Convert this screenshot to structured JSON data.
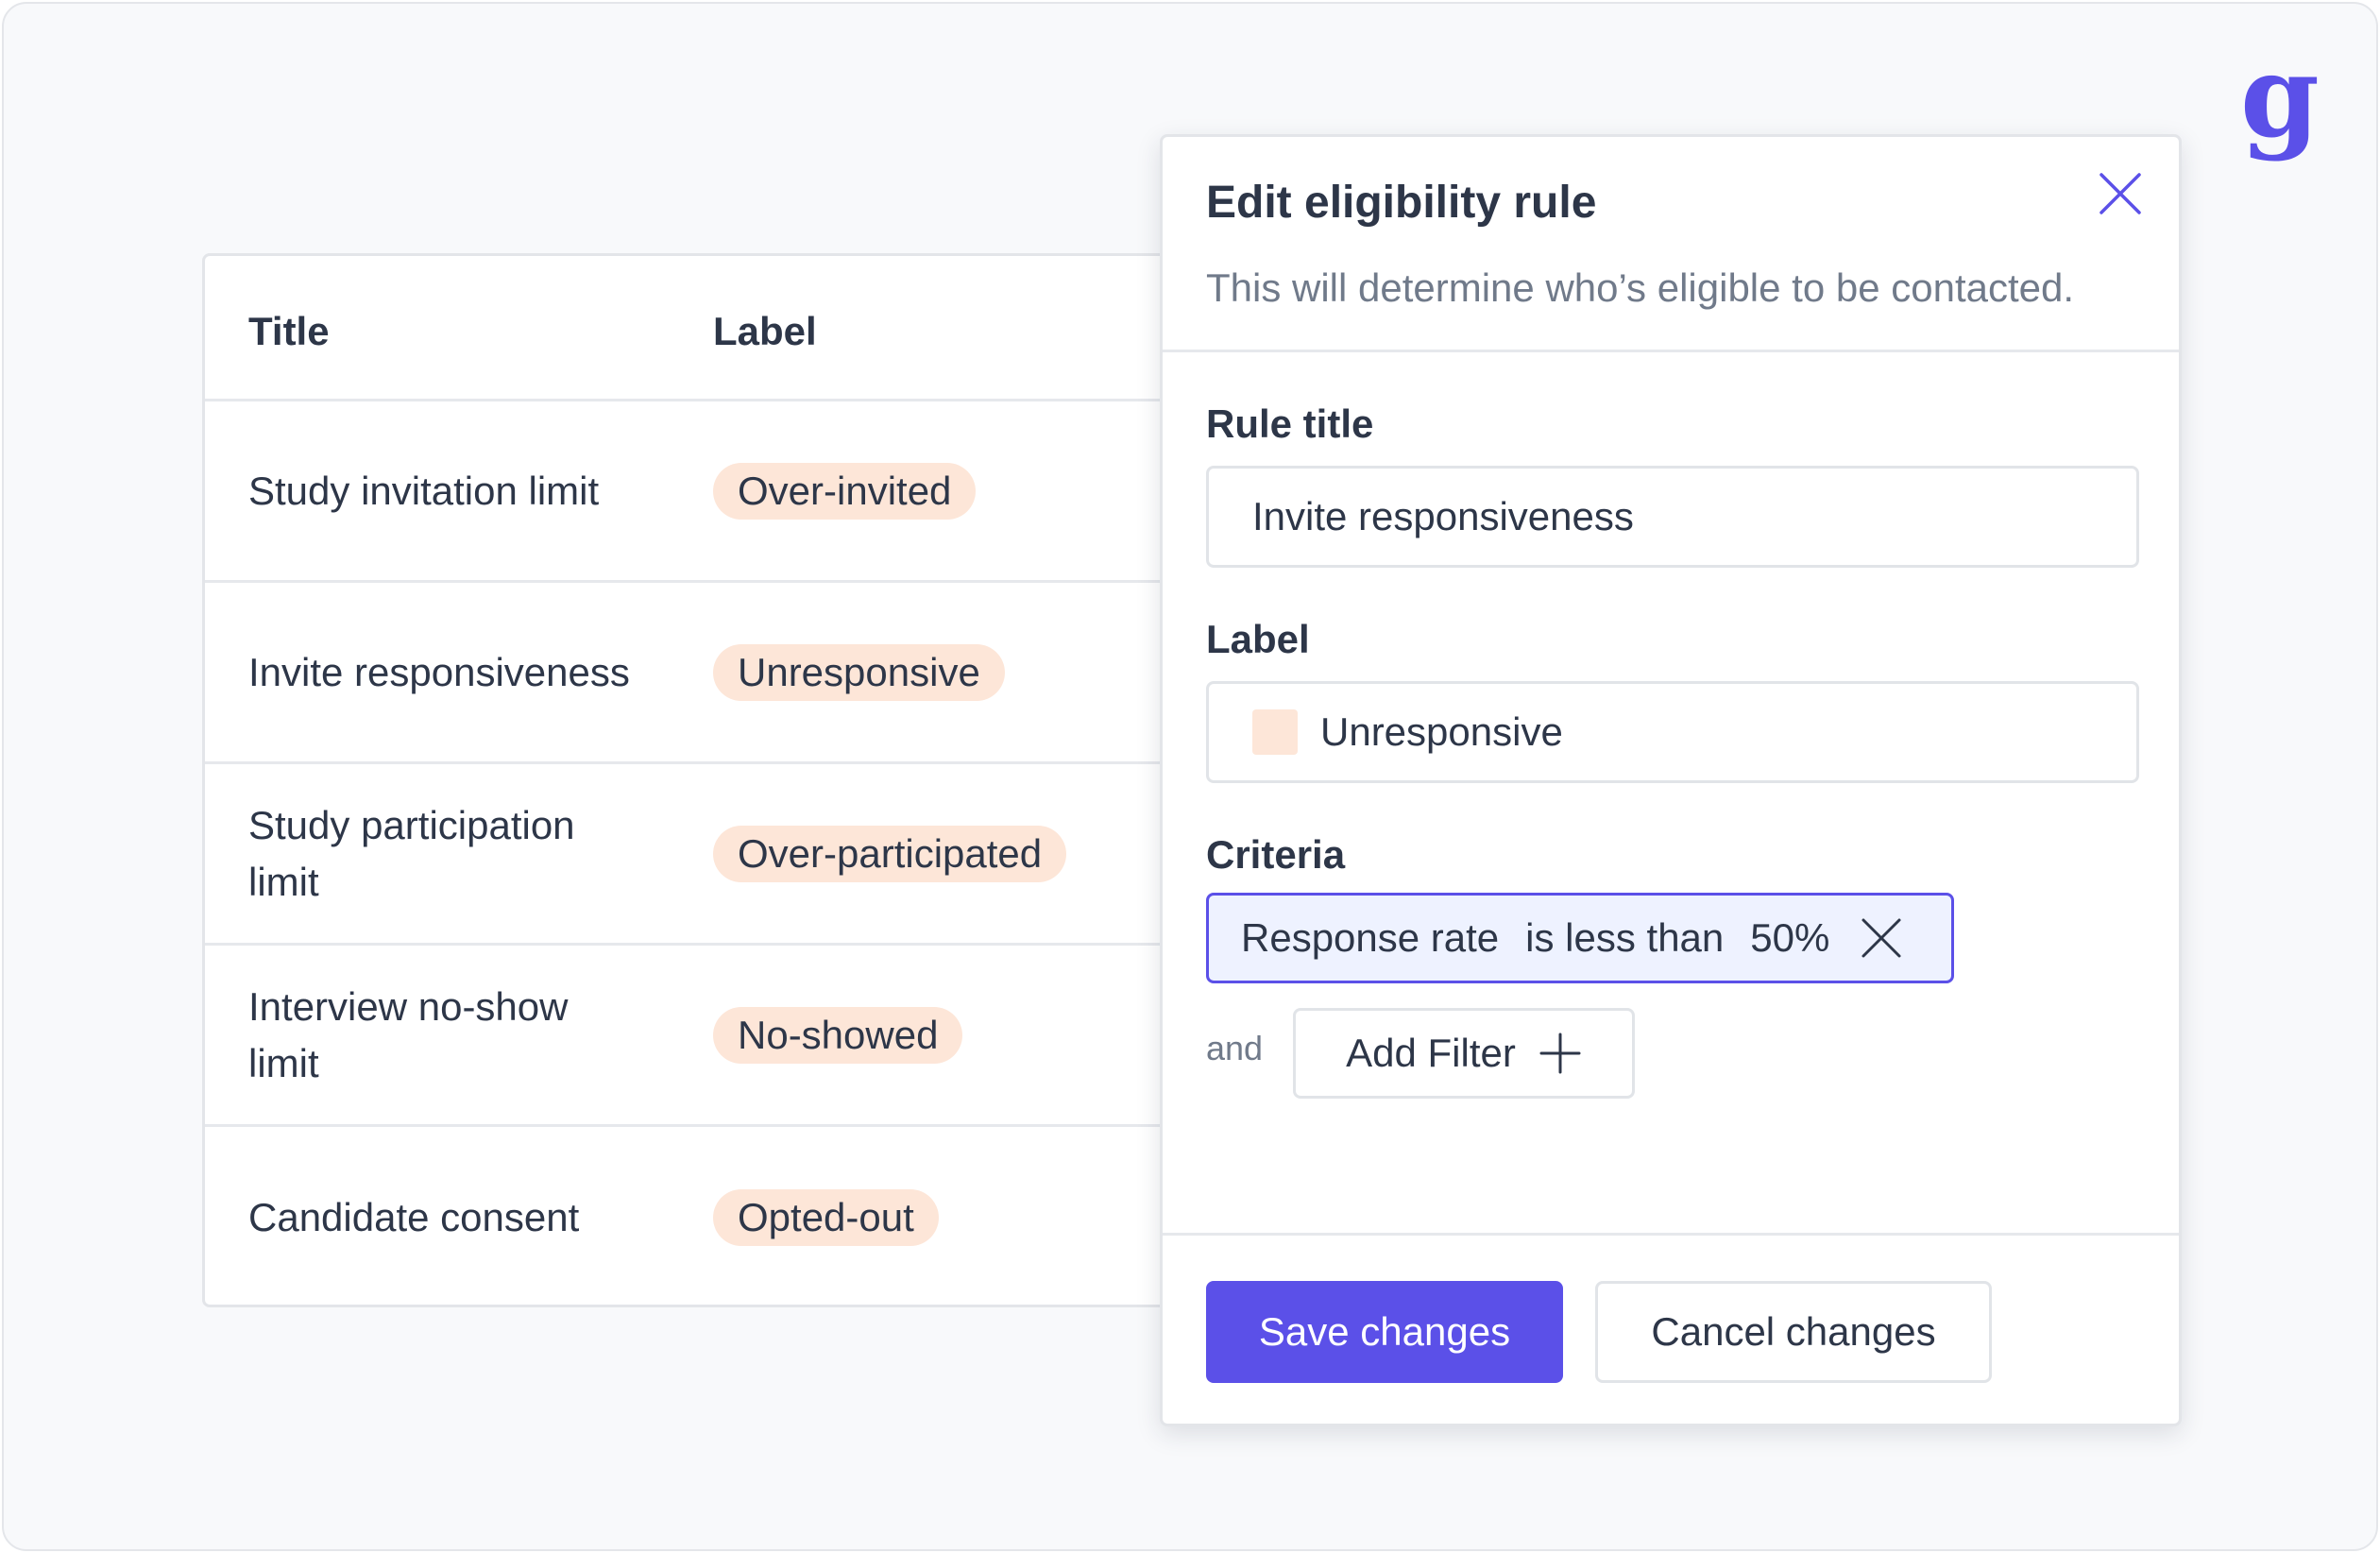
{
  "table": {
    "headers": {
      "title": "Title",
      "label": "Label"
    },
    "rows": [
      {
        "title": "Study invitation limit",
        "label": "Over-invited"
      },
      {
        "title": "Invite responsiveness",
        "label": "Unresponsive"
      },
      {
        "title": "Study participation limit",
        "label": "Over-participated"
      },
      {
        "title": "Interview no-show limit",
        "label": "No-showed"
      },
      {
        "title": "Candidate consent",
        "label": "Opted-out"
      }
    ]
  },
  "modal": {
    "title": "Edit eligibility rule",
    "subtitle": "This will determine who’s eligible to be contacted.",
    "rule_title_label": "Rule title",
    "rule_title_value": "Invite responsiveness",
    "label_label": "Label",
    "label_value": "Unresponsive",
    "criteria_label": "Criteria",
    "criteria": {
      "field": "Response rate",
      "operator": "is less than",
      "value": "50%"
    },
    "and_text": "and",
    "add_filter_label": "Add Filter",
    "save_label": "Save changes",
    "cancel_label": "Cancel changes"
  },
  "colors": {
    "accent": "#5b50e8",
    "label_pill": "#fde6d8",
    "criteria_bg": "#eef2ff"
  },
  "icons": {
    "logo": "g-logo-icon",
    "close": "close-icon",
    "remove_criteria": "close-icon",
    "add": "plus-icon"
  }
}
